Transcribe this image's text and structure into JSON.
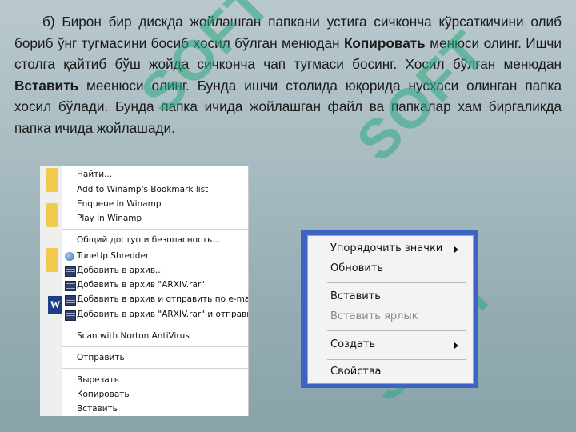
{
  "paragraph": {
    "part1": "б) Бирон бир дискда жойлашган папкани устига сичкончa кўрсаткичини олиб бориб ўнг тугмасини босиб хосил бўлган менюдан ",
    "bold1": "Копировать",
    "part2": " менюси олинг. Ишчи столга қайтиб бўш жойда сичконча чап тугмаси босинг. Хосил бўлган менюдан ",
    "bold2": "Вставить",
    "part3": " меенюси олинг. Бунда ишчи столида юқорида нусхаси олинган папка хосил бўлади. Бунда папка ичида жойлашган файл ва папкалар хам биргаликда папка ичида жойлашади."
  },
  "watermark_text": "SOFT",
  "menu_left": {
    "items": [
      "Найти...",
      "Add to Winamp's Bookmark list",
      "Enqueue in Winamp",
      "Play in Winamp",
      "Общий доступ и безопасность...",
      "TuneUp Shredder",
      "Добавить в архив...",
      "Добавить в архив \"ARXIV.rar\"",
      "Добавить в архив и отправить по e-mail...",
      "Добавить в архив \"ARXIV.rar\" и отправить",
      "Scan with Norton AntiVirus",
      "Отправить",
      "Вырезать",
      "Копировать",
      "Вставить"
    ],
    "word_icon_letter": "W"
  },
  "menu_right": {
    "items": [
      "Упорядочить значки",
      "Обновить",
      "Вставить",
      "Вставить ярлык",
      "Создать",
      "Свойства"
    ],
    "disabled": [
      "Вставить ярлык"
    ],
    "frame_color": "#3d63c6"
  }
}
